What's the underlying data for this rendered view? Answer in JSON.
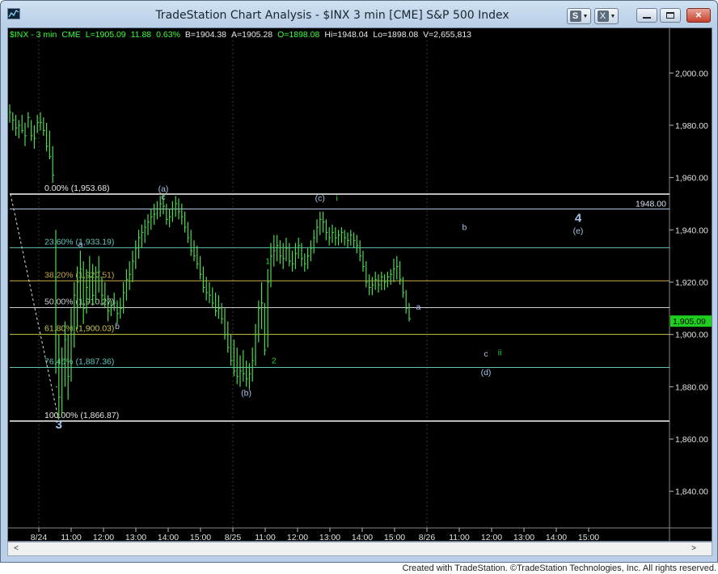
{
  "window": {
    "title": "TradeStation Chart Analysis - $INX 3 min [CME] S&P 500 Index",
    "s_button_label": "S",
    "x_button_label": "X"
  },
  "status": {
    "symbol": "$INX - 3 min",
    "exchange": "CME",
    "last": "L=1905.09",
    "change": "11.88",
    "pct": "0.63%",
    "bid": "B=1904.38",
    "ask": "A=1905.28",
    "open": "O=1898.08",
    "high": "Hi=1948.04",
    "low": "Lo=1898.08",
    "volume": "V=2,655,813"
  },
  "footer": "Created with TradeStation. ©TradeStation Technologies, Inc. All rights reserved.",
  "colors": {
    "price": "#4fd84f",
    "wave_label": "#a9c4e6",
    "minor_label": "#2fd02f",
    "fib_0": "#e6e6e6",
    "fib_236": "#66c2b8",
    "fib_382": "#c8a84a",
    "fib_50": "#cfcfcf",
    "fib_618": "#c8c84a",
    "fib_764": "#66c2b8",
    "fib_100": "#e6e6e6",
    "last_tag_bg": "#1ecf1e",
    "line_1948": "#a9c4e6"
  },
  "chart_data": {
    "type": "bar",
    "title": "$INX - 3 min",
    "ylim": [
      1826,
      2014
    ],
    "y_ticks": [
      "2,000.00",
      "1,980.00",
      "1,960.00",
      "1,940.00",
      "1,920.00",
      "1,900.00",
      "1,880.00",
      "1,860.00",
      "1,840.00"
    ],
    "y_tick_values": [
      2000,
      1980,
      1960,
      1940,
      1920,
      1900,
      1880,
      1860,
      1840
    ],
    "x_ticks": [
      "8/24",
      "11:00",
      "12:00",
      "13:00",
      "14:00",
      "15:00",
      "8/25",
      "11:00",
      "12:00",
      "13:00",
      "14:00",
      "15:00",
      "8/26",
      "11:00",
      "12:00",
      "13:00",
      "14:00",
      "15:00"
    ],
    "last_price_tag": "1,905.09",
    "level_tag": "1948.00",
    "level_value": 1948.0,
    "fib_levels": [
      {
        "label": "0.00% (1,953.68)",
        "value": 1953.68
      },
      {
        "label": "23.60% (1,933.19)",
        "value": 1933.19
      },
      {
        "label": "38.20% (1,920.51)",
        "value": 1920.51
      },
      {
        "label": "50.00% (1,910.27)",
        "value": 1910.27
      },
      {
        "label": "61.80% (1,900.03)",
        "value": 1900.03
      },
      {
        "label": "76.40% (1,887.36)",
        "value": 1887.36
      },
      {
        "label": "100.00% (1,866.87)",
        "value": 1866.87
      }
    ],
    "price_series": [
      [
        0,
        1988,
        1981,
        1985
      ],
      [
        2,
        1985,
        1978,
        1982
      ],
      [
        4,
        1984,
        1976,
        1979
      ],
      [
        6,
        1982,
        1975,
        1980
      ],
      [
        8,
        1984,
        1977,
        1978
      ],
      [
        10,
        1981,
        1972,
        1976
      ],
      [
        12,
        1985,
        1979,
        1983
      ],
      [
        14,
        1982,
        1974,
        1976
      ],
      [
        16,
        1980,
        1971,
        1975
      ],
      [
        18,
        1984,
        1977,
        1981
      ],
      [
        20,
        1985,
        1978,
        1981
      ],
      [
        22,
        1983,
        1976,
        1978
      ],
      [
        24,
        1981,
        1970,
        1972
      ],
      [
        26,
        1978,
        1967,
        1968
      ],
      [
        28,
        1972,
        1958,
        1961
      ],
      [
        30,
        1940,
        1885,
        1880
      ],
      [
        32,
        1900,
        1868,
        1876
      ],
      [
        34,
        1895,
        1870,
        1890
      ],
      [
        36,
        1905,
        1880,
        1898
      ],
      [
        38,
        1900,
        1875,
        1884
      ],
      [
        40,
        1910,
        1882,
        1903
      ],
      [
        42,
        1920,
        1895,
        1915
      ],
      [
        44,
        1926,
        1902,
        1920
      ],
      [
        46,
        1932,
        1910,
        1925
      ],
      [
        48,
        1928,
        1904,
        1910
      ],
      [
        50,
        1925,
        1908,
        1918
      ],
      [
        52,
        1930,
        1912,
        1922
      ],
      [
        54,
        1927,
        1911,
        1915
      ],
      [
        56,
        1926,
        1912,
        1922
      ],
      [
        58,
        1930,
        1916,
        1924
      ],
      [
        60,
        1922,
        1911,
        1915
      ],
      [
        62,
        1920,
        1910,
        1913
      ],
      [
        64,
        1915,
        1905,
        1909
      ],
      [
        66,
        1913,
        1907,
        1911
      ],
      [
        68,
        1916,
        1909,
        1912
      ],
      [
        70,
        1913,
        1904,
        1908
      ],
      [
        72,
        1914,
        1906,
        1910
      ],
      [
        74,
        1920,
        1908,
        1916
      ],
      [
        76,
        1925,
        1913,
        1921
      ],
      [
        78,
        1928,
        1917,
        1923
      ],
      [
        80,
        1932,
        1920,
        1928
      ],
      [
        82,
        1936,
        1925,
        1933
      ],
      [
        84,
        1940,
        1929,
        1937
      ],
      [
        86,
        1942,
        1933,
        1939
      ],
      [
        88,
        1944,
        1935,
        1941
      ],
      [
        90,
        1946,
        1938,
        1943
      ],
      [
        92,
        1948,
        1940,
        1945
      ],
      [
        94,
        1950,
        1942,
        1946
      ],
      [
        96,
        1951,
        1944,
        1948
      ],
      [
        98,
        1953,
        1945,
        1950
      ],
      [
        100,
        1953.7,
        1946,
        1949
      ],
      [
        102,
        1950,
        1942,
        1944
      ],
      [
        104,
        1948,
        1941,
        1945
      ],
      [
        106,
        1951,
        1943,
        1948
      ],
      [
        108,
        1953,
        1945,
        1950
      ],
      [
        110,
        1952,
        1944,
        1947
      ],
      [
        112,
        1950,
        1942,
        1945
      ],
      [
        114,
        1947,
        1939,
        1941
      ],
      [
        116,
        1943,
        1935,
        1937
      ],
      [
        118,
        1940,
        1930,
        1932
      ],
      [
        120,
        1936,
        1928,
        1930
      ],
      [
        122,
        1934,
        1925,
        1927
      ],
      [
        124,
        1930,
        1921,
        1923
      ],
      [
        126,
        1926,
        1916,
        1918
      ],
      [
        128,
        1922,
        1913,
        1916
      ],
      [
        130,
        1920,
        1912,
        1915
      ],
      [
        132,
        1918,
        1910,
        1912
      ],
      [
        134,
        1916,
        1907,
        1909
      ],
      [
        136,
        1915,
        1906,
        1910
      ],
      [
        138,
        1912,
        1904,
        1906
      ],
      [
        140,
        1910,
        1898,
        1900
      ],
      [
        142,
        1905,
        1893,
        1895
      ],
      [
        144,
        1900,
        1888,
        1890
      ],
      [
        146,
        1898,
        1884,
        1886
      ],
      [
        148,
        1895,
        1881,
        1884
      ],
      [
        150,
        1892,
        1880,
        1886
      ],
      [
        152,
        1894,
        1882,
        1885
      ],
      [
        154,
        1890,
        1880,
        1883
      ],
      [
        156,
        1889,
        1879,
        1885
      ],
      [
        158,
        1895,
        1882,
        1890
      ],
      [
        160,
        1904,
        1888,
        1900
      ],
      [
        162,
        1913,
        1897,
        1910
      ],
      [
        164,
        1920,
        1902,
        1912
      ],
      [
        166,
        1912,
        1892,
        1894
      ],
      [
        168,
        1925,
        1895,
        1920
      ],
      [
        170,
        1935,
        1918,
        1930
      ],
      [
        172,
        1938,
        1926,
        1932
      ],
      [
        174,
        1938,
        1928,
        1934
      ],
      [
        176,
        1936,
        1927,
        1930
      ],
      [
        178,
        1935,
        1925,
        1929
      ],
      [
        180,
        1937,
        1928,
        1933
      ],
      [
        182,
        1935,
        1926,
        1928
      ],
      [
        184,
        1932,
        1924,
        1927
      ],
      [
        186,
        1935,
        1925,
        1931
      ],
      [
        188,
        1937,
        1929,
        1934
      ],
      [
        190,
        1935,
        1926,
        1929
      ],
      [
        192,
        1931,
        1924,
        1927
      ],
      [
        194,
        1933,
        1925,
        1930
      ],
      [
        196,
        1936,
        1928,
        1933
      ],
      [
        198,
        1940,
        1931,
        1937
      ],
      [
        200,
        1944,
        1935,
        1941
      ],
      [
        202,
        1947,
        1938,
        1944
      ],
      [
        204,
        1947,
        1939,
        1943
      ],
      [
        206,
        1944,
        1936,
        1939
      ],
      [
        208,
        1941,
        1934,
        1937
      ],
      [
        210,
        1942,
        1935,
        1939
      ],
      [
        212,
        1941,
        1934,
        1937
      ],
      [
        214,
        1940,
        1934,
        1938
      ],
      [
        216,
        1941,
        1935,
        1939
      ],
      [
        218,
        1940,
        1934,
        1937
      ],
      [
        220,
        1939,
        1933,
        1936
      ],
      [
        222,
        1940,
        1934,
        1938
      ],
      [
        224,
        1939,
        1933,
        1936
      ],
      [
        226,
        1938,
        1931,
        1934
      ],
      [
        228,
        1936,
        1928,
        1930
      ],
      [
        230,
        1932,
        1924,
        1926
      ],
      [
        232,
        1928,
        1918,
        1920
      ],
      [
        234,
        1923,
        1915,
        1918
      ],
      [
        236,
        1922,
        1915,
        1919
      ],
      [
        238,
        1924,
        1917,
        1921
      ],
      [
        240,
        1923,
        1916,
        1919
      ],
      [
        242,
        1924,
        1917,
        1922
      ],
      [
        244,
        1923,
        1917,
        1920
      ],
      [
        246,
        1924,
        1918,
        1922
      ],
      [
        248,
        1925,
        1919,
        1923
      ],
      [
        250,
        1929,
        1920,
        1925
      ],
      [
        252,
        1930,
        1921,
        1926
      ],
      [
        254,
        1928,
        1919,
        1921
      ],
      [
        256,
        1922,
        1914,
        1916
      ],
      [
        258,
        1917,
        1908,
        1910
      ],
      [
        260,
        1912,
        1905,
        1906
      ]
    ],
    "x_index_ticks": [
      0,
      24,
      48,
      72,
      96,
      120,
      144,
      168,
      192,
      216,
      240,
      264,
      288,
      312,
      336,
      360,
      384,
      408
    ],
    "wave_labels": [
      {
        "text": "(a)",
        "i": 100,
        "v": 1954.6,
        "kind": "wave"
      },
      {
        "text": "c",
        "i": 100,
        "v": 1951.5,
        "kind": "wave"
      },
      {
        "text": "a",
        "i": 46,
        "v": 1933.5,
        "kind": "wave"
      },
      {
        "text": "b",
        "i": 70,
        "v": 1902,
        "kind": "wave"
      },
      {
        "text": "(b)",
        "i": 154,
        "v": 1876.5,
        "kind": "wave"
      },
      {
        "text": "1",
        "i": 168,
        "v": 1927,
        "kind": "minor"
      },
      {
        "text": "2",
        "i": 172,
        "v": 1889,
        "kind": "minor"
      },
      {
        "text": "(c)",
        "i": 202,
        "v": 1951,
        "kind": "wave"
      },
      {
        "text": "i",
        "i": 213,
        "v": 1951,
        "kind": "minor"
      },
      {
        "text": "a",
        "i": 266,
        "v": 1909.5,
        "kind": "wave"
      },
      {
        "text": "b",
        "i": 296,
        "v": 1940,
        "kind": "wave"
      },
      {
        "text": "c",
        "i": 310,
        "v": 1891.5,
        "kind": "wave"
      },
      {
        "text": "ii",
        "i": 319,
        "v": 1892,
        "kind": "minor"
      },
      {
        "text": "(d)",
        "i": 310,
        "v": 1884.5,
        "kind": "wave"
      },
      {
        "text": "4",
        "i": 370,
        "v": 1943,
        "kind": "big"
      },
      {
        "text": "(e)",
        "i": 370,
        "v": 1938.5,
        "kind": "wave"
      },
      {
        "text": "3",
        "i": 32,
        "v": 1864,
        "kind": "big"
      }
    ]
  }
}
